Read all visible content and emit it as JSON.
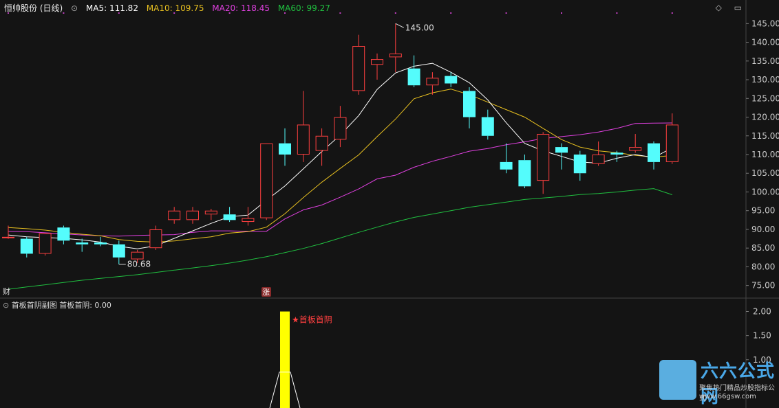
{
  "header": {
    "stock_name": "恒帅股份 (日线)",
    "ma5_label": "MA5: 111.82",
    "ma10_label": "MA10: 109.75",
    "ma20_label": "MA20: 118.45",
    "ma60_label": "MA60: 99.27",
    "diamond_icon": "diamond-icon",
    "menu_icon": "menu-icon"
  },
  "colors": {
    "up": "#ff4040",
    "down": "#54fcfc",
    "ma5": "#ffffff",
    "ma10": "#e8c020",
    "ma20": "#e040e0",
    "ma60": "#20c040",
    "indicator_bar": "#ffff00"
  },
  "markers": {
    "high_label": "145.00",
    "low_label": "80.68",
    "badge_cai": "财",
    "badge_zhang": "涨"
  },
  "sub_chart": {
    "title": "首板首阴副图",
    "value_label": "首板首阴: 0.00",
    "signal_label": "★首板首阴"
  },
  "watermark": {
    "brand": "六六公式网",
    "slogan": "聚焦热门精品炒股指标公式",
    "url": "www.66gsw.com"
  },
  "chart_data": {
    "type": "candlestick",
    "ylim": [
      72,
      148
    ],
    "yticks": [
      75,
      80,
      85,
      90,
      95,
      100,
      105,
      110,
      115,
      120,
      125,
      130,
      135,
      140,
      145
    ],
    "sub_ylim": [
      0,
      2.05
    ],
    "sub_yticks": [
      "1.00",
      "1.50",
      "2.00"
    ],
    "candles": [
      {
        "o": 88.0,
        "h": 91.0,
        "l": 87.5,
        "c": 88.0
      },
      {
        "o": 87.5,
        "h": 88.0,
        "l": 82.5,
        "c": 83.5
      },
      {
        "o": 83.5,
        "h": 89.0,
        "l": 83.0,
        "c": 89.0
      },
      {
        "o": 90.5,
        "h": 91.0,
        "l": 86.0,
        "c": 87.0
      },
      {
        "o": 86.5,
        "h": 87.5,
        "l": 84.0,
        "c": 86.0
      },
      {
        "o": 86.5,
        "h": 88.0,
        "l": 85.5,
        "c": 86.0
      },
      {
        "o": 86.0,
        "h": 87.0,
        "l": 80.68,
        "c": 82.5
      },
      {
        "o": 82.0,
        "h": 84.5,
        "l": 81.0,
        "c": 84.0
      },
      {
        "o": 85.0,
        "h": 91.0,
        "l": 84.5,
        "c": 90.0
      },
      {
        "o": 92.5,
        "h": 96.0,
        "l": 91.5,
        "c": 95.0
      },
      {
        "o": 92.5,
        "h": 96.0,
        "l": 91.5,
        "c": 95.0
      },
      {
        "o": 94.0,
        "h": 95.5,
        "l": 92.5,
        "c": 95.0
      },
      {
        "o": 94.0,
        "h": 96.0,
        "l": 92.0,
        "c": 92.5
      },
      {
        "o": 92.0,
        "h": 96.0,
        "l": 91.0,
        "c": 93.0
      },
      {
        "o": 93.0,
        "h": 113.0,
        "l": 92.5,
        "c": 113.0
      },
      {
        "o": 113.0,
        "h": 117.0,
        "l": 107.0,
        "c": 110.0
      },
      {
        "o": 110.0,
        "h": 127.0,
        "l": 108.0,
        "c": 118.0
      },
      {
        "o": 111.0,
        "h": 117.0,
        "l": 107.0,
        "c": 115.0
      },
      {
        "o": 114.0,
        "h": 123.0,
        "l": 112.0,
        "c": 120.0
      },
      {
        "o": 127.0,
        "h": 142.0,
        "l": 126.0,
        "c": 139.0
      },
      {
        "o": 134.0,
        "h": 137.0,
        "l": 130.0,
        "c": 135.5
      },
      {
        "o": 136.0,
        "h": 145.0,
        "l": 132.0,
        "c": 137.0
      },
      {
        "o": 133.0,
        "h": 136.5,
        "l": 128.0,
        "c": 128.5
      },
      {
        "o": 128.5,
        "h": 132.0,
        "l": 126.0,
        "c": 130.5
      },
      {
        "o": 131.0,
        "h": 132.0,
        "l": 128.0,
        "c": 129.0
      },
      {
        "o": 127.0,
        "h": 128.0,
        "l": 117.0,
        "c": 120.0
      },
      {
        "o": 120.0,
        "h": 122.0,
        "l": 114.0,
        "c": 115.0
      },
      {
        "o": 108.0,
        "h": 113.0,
        "l": 105.0,
        "c": 106.0
      },
      {
        "o": 108.5,
        "h": 110.0,
        "l": 101.0,
        "c": 101.5
      },
      {
        "o": 103.0,
        "h": 116.0,
        "l": 99.5,
        "c": 115.5
      },
      {
        "o": 112.0,
        "h": 113.0,
        "l": 106.0,
        "c": 110.5
      },
      {
        "o": 110.0,
        "h": 111.0,
        "l": 103.0,
        "c": 105.0
      },
      {
        "o": 107.5,
        "h": 113.5,
        "l": 107.0,
        "c": 110.0
      },
      {
        "o": 110.5,
        "h": 111.0,
        "l": 108.0,
        "c": 110.0
      },
      {
        "o": 111.0,
        "h": 115.5,
        "l": 110.5,
        "c": 112.0
      },
      {
        "o": 113.0,
        "h": 113.5,
        "l": 106.0,
        "c": 108.0
      },
      {
        "o": 108.0,
        "h": 121.0,
        "l": 107.5,
        "c": 118.0
      }
    ],
    "ma5": [
      88.5,
      88.0,
      87.8,
      87.6,
      87.2,
      86.6,
      85.5,
      84.8,
      85.6,
      87.6,
      89.6,
      91.6,
      93.4,
      93.8,
      97.8,
      101.6,
      106.2,
      110.8,
      115.2,
      120.4,
      127.4,
      131.8,
      133.6,
      134.4,
      132.0,
      129.2,
      124.6,
      118.5,
      113.0,
      111.0,
      109.5,
      108.0,
      107.7,
      109.0,
      110.0,
      109.2,
      111.8
    ],
    "ma10": [
      90.5,
      90.2,
      89.8,
      89.2,
      88.7,
      88.3,
      87.3,
      86.8,
      86.6,
      86.9,
      87.5,
      88.0,
      89.0,
      89.4,
      90.6,
      94.2,
      98.5,
      102.6,
      106.3,
      109.9,
      114.8,
      119.5,
      124.9,
      126.5,
      127.5,
      126.0,
      124.0,
      122.0,
      120.0,
      117.0,
      114.0,
      112.0,
      111.0,
      110.5,
      109.8,
      109.3,
      109.75
    ],
    "ma20": [
      89.5,
      89.4,
      89.1,
      88.8,
      88.5,
      88.3,
      88.2,
      88.4,
      88.5,
      88.6,
      89.2,
      89.6,
      89.6,
      89.5,
      89.5,
      92.8,
      95.2,
      96.5,
      98.6,
      100.8,
      103.5,
      104.5,
      106.6,
      108.2,
      109.5,
      110.9,
      111.6,
      112.6,
      113.4,
      114.3,
      114.8,
      115.3,
      116.0,
      117.0,
      118.3,
      118.4,
      118.45
    ],
    "ma60": [
      74.0,
      74.6,
      75.2,
      75.8,
      76.4,
      76.9,
      77.4,
      77.9,
      78.5,
      79.1,
      79.7,
      80.3,
      81.0,
      81.8,
      82.7,
      83.8,
      84.9,
      86.2,
      87.7,
      89.2,
      90.6,
      92.0,
      93.2,
      94.1,
      95.0,
      95.9,
      96.6,
      97.3,
      98.0,
      98.4,
      98.8,
      99.3,
      99.6,
      100.0,
      100.5,
      100.9,
      99.27
    ],
    "signal_index": 15,
    "signal_value": 2.0
  }
}
